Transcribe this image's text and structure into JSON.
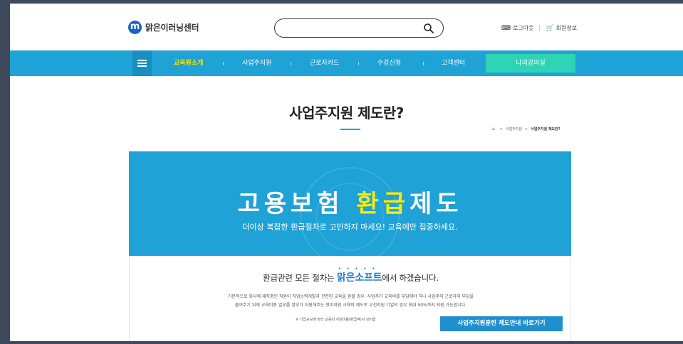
{
  "header": {
    "logo_mark": "m",
    "logo_text": "맑은이러닝센터",
    "search": {
      "value": "",
      "placeholder": ""
    },
    "util": [
      {
        "icon": "logout-icon",
        "label": "로그아웃"
      },
      {
        "icon": "cart-icon",
        "label": "회원정보"
      }
    ]
  },
  "nav": {
    "items": [
      "교육원소개",
      "사업주지원",
      "근로자카드",
      "수강신청",
      "고객센터"
    ],
    "active_index": 0,
    "cta": "나의강의실"
  },
  "page": {
    "title": "사업주지원 제도란?",
    "breadcrumb": [
      "사업주지원",
      "사업주지원 제도란?"
    ]
  },
  "banner": {
    "headline_pre": "고용보험 ",
    "headline_highlight": "환급",
    "headline_post": "제도",
    "subtitle": "더이상 복잡한 환급절차로 고민하지 마세요! 교육에만 집중하세요."
  },
  "info": {
    "lead_pre": "환급관련 모든 절차는 ",
    "lead_brand": "맑은소프트",
    "lead_post": "에서 하겠습니다.",
    "text_line1": "기본적으로 회사에 재직중인 직원이 직업능력개발과 관련된 교육을 원할 경우, 사업주가 교육비를 부담해야 하나 사업주의 근로자의 부담을",
    "text_line2": "줄여주기 위해 교육비중 일부를 정부가 지원해주는 형비지원 교육비 제도로 우선지원 기업의 경우 최대 90%까지 지원 가능합니다.",
    "note": "※ 기업규모에 따라 교육비 지원비율(환급액)이 상이함",
    "button": "사업주지원훈련 제도안내 바로가기"
  },
  "colors": {
    "accent": "#1fa2d6",
    "active_nav": "#f5e600",
    "cta": "#2fd4b4",
    "button": "#1f8fd0",
    "frame_bg": "#3d4a5c"
  }
}
